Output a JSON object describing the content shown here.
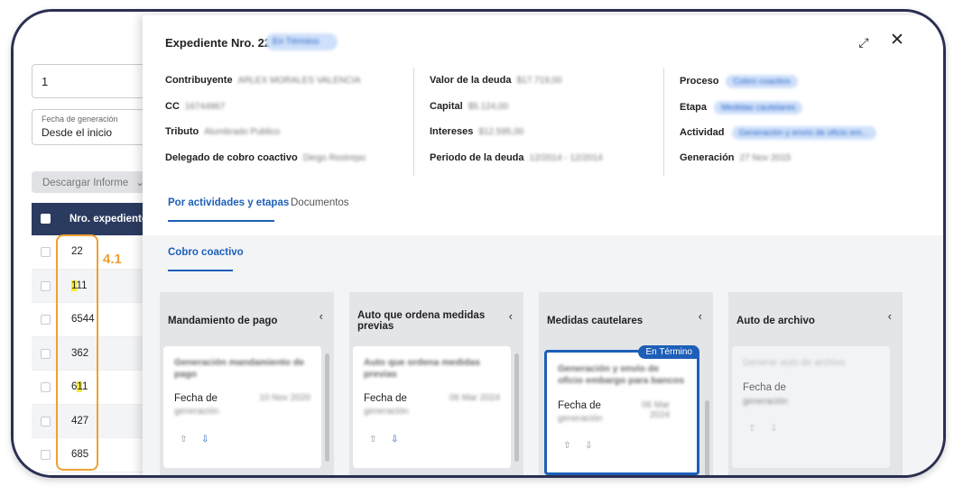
{
  "background": {
    "search_value": "1",
    "date_filter": {
      "label": "Fecha de generación",
      "value": "Desde el inicio"
    },
    "download_label": "Descargar Informe",
    "table_header": "Nro. expediente",
    "rows": [
      {
        "pre": "",
        "hl": "",
        "post": "22"
      },
      {
        "pre": "",
        "hl": "1",
        "post": "11"
      },
      {
        "pre": "",
        "hl": "",
        "post": "6544"
      },
      {
        "pre": "",
        "hl": "",
        "post": "362"
      },
      {
        "pre": "6",
        "hl": "1",
        "post": "1"
      },
      {
        "pre": "",
        "hl": "",
        "post": "427"
      },
      {
        "pre": "",
        "hl": "",
        "post": "685"
      }
    ],
    "annotation_label": "4.1"
  },
  "panel": {
    "title": "Expediente Nro. 22",
    "status_badge": "En Término",
    "info": {
      "col1": [
        {
          "key": "Contribuyente",
          "value": "ARLEX MORALES VALENCIA"
        },
        {
          "key": "CC",
          "value": "16744867"
        },
        {
          "key": "Tributo",
          "value": "Alumbrado Publico"
        },
        {
          "key": "Delegado de cobro coactivo",
          "value": "Diego Restrepo"
        }
      ],
      "col2": [
        {
          "key": "Valor de la deuda",
          "value": "$17.719,00"
        },
        {
          "key": "Capital",
          "value": "$5.124,00"
        },
        {
          "key": "Intereses",
          "value": "$12.595,00"
        },
        {
          "key": "Periodo de la deuda",
          "value": "12/2014 - 12/2014"
        }
      ],
      "col3": [
        {
          "key": "Proceso",
          "value": "Cobro coactivo"
        },
        {
          "key": "Etapa",
          "value": "Medidas cautelares"
        },
        {
          "key": "Actividad",
          "value": "Generación y envío de oficio em..."
        },
        {
          "key": "Generación",
          "value": "27 Nov 2015"
        }
      ]
    },
    "tabs": {
      "active": "Por actividades y etapas",
      "other": "Documentos"
    },
    "subtab": "Cobro coactivo",
    "stages": [
      {
        "name": "Mandamiento de pago",
        "card_title": "Generación mandamiento de pago",
        "date_label": "Fecha de",
        "date_sub": "generación",
        "date_value": "10 Nov 2020"
      },
      {
        "name": "Auto que ordena medidas previas",
        "card_title": "Auto que ordena medidas previas",
        "date_label": "Fecha de",
        "date_sub": "generación",
        "date_value": "06 Mar 2024"
      },
      {
        "name": "Medidas cautelares",
        "card_title": "Generación y envío de oficio embargo para bancos",
        "date_label": "Fecha de",
        "date_sub": "generación",
        "date_value": "06 Mar 2024",
        "tag": "En Término"
      },
      {
        "name": "Auto de archivo",
        "card_title": "Generar auto de archivo",
        "date_label": "Fecha de",
        "date_sub": "generación",
        "date_value": ""
      }
    ],
    "icons": {
      "expand": "expand-icon",
      "close": "close-icon",
      "chevron": "chevron-left-icon",
      "upload": "upload-icon",
      "download": "download-icon"
    }
  }
}
